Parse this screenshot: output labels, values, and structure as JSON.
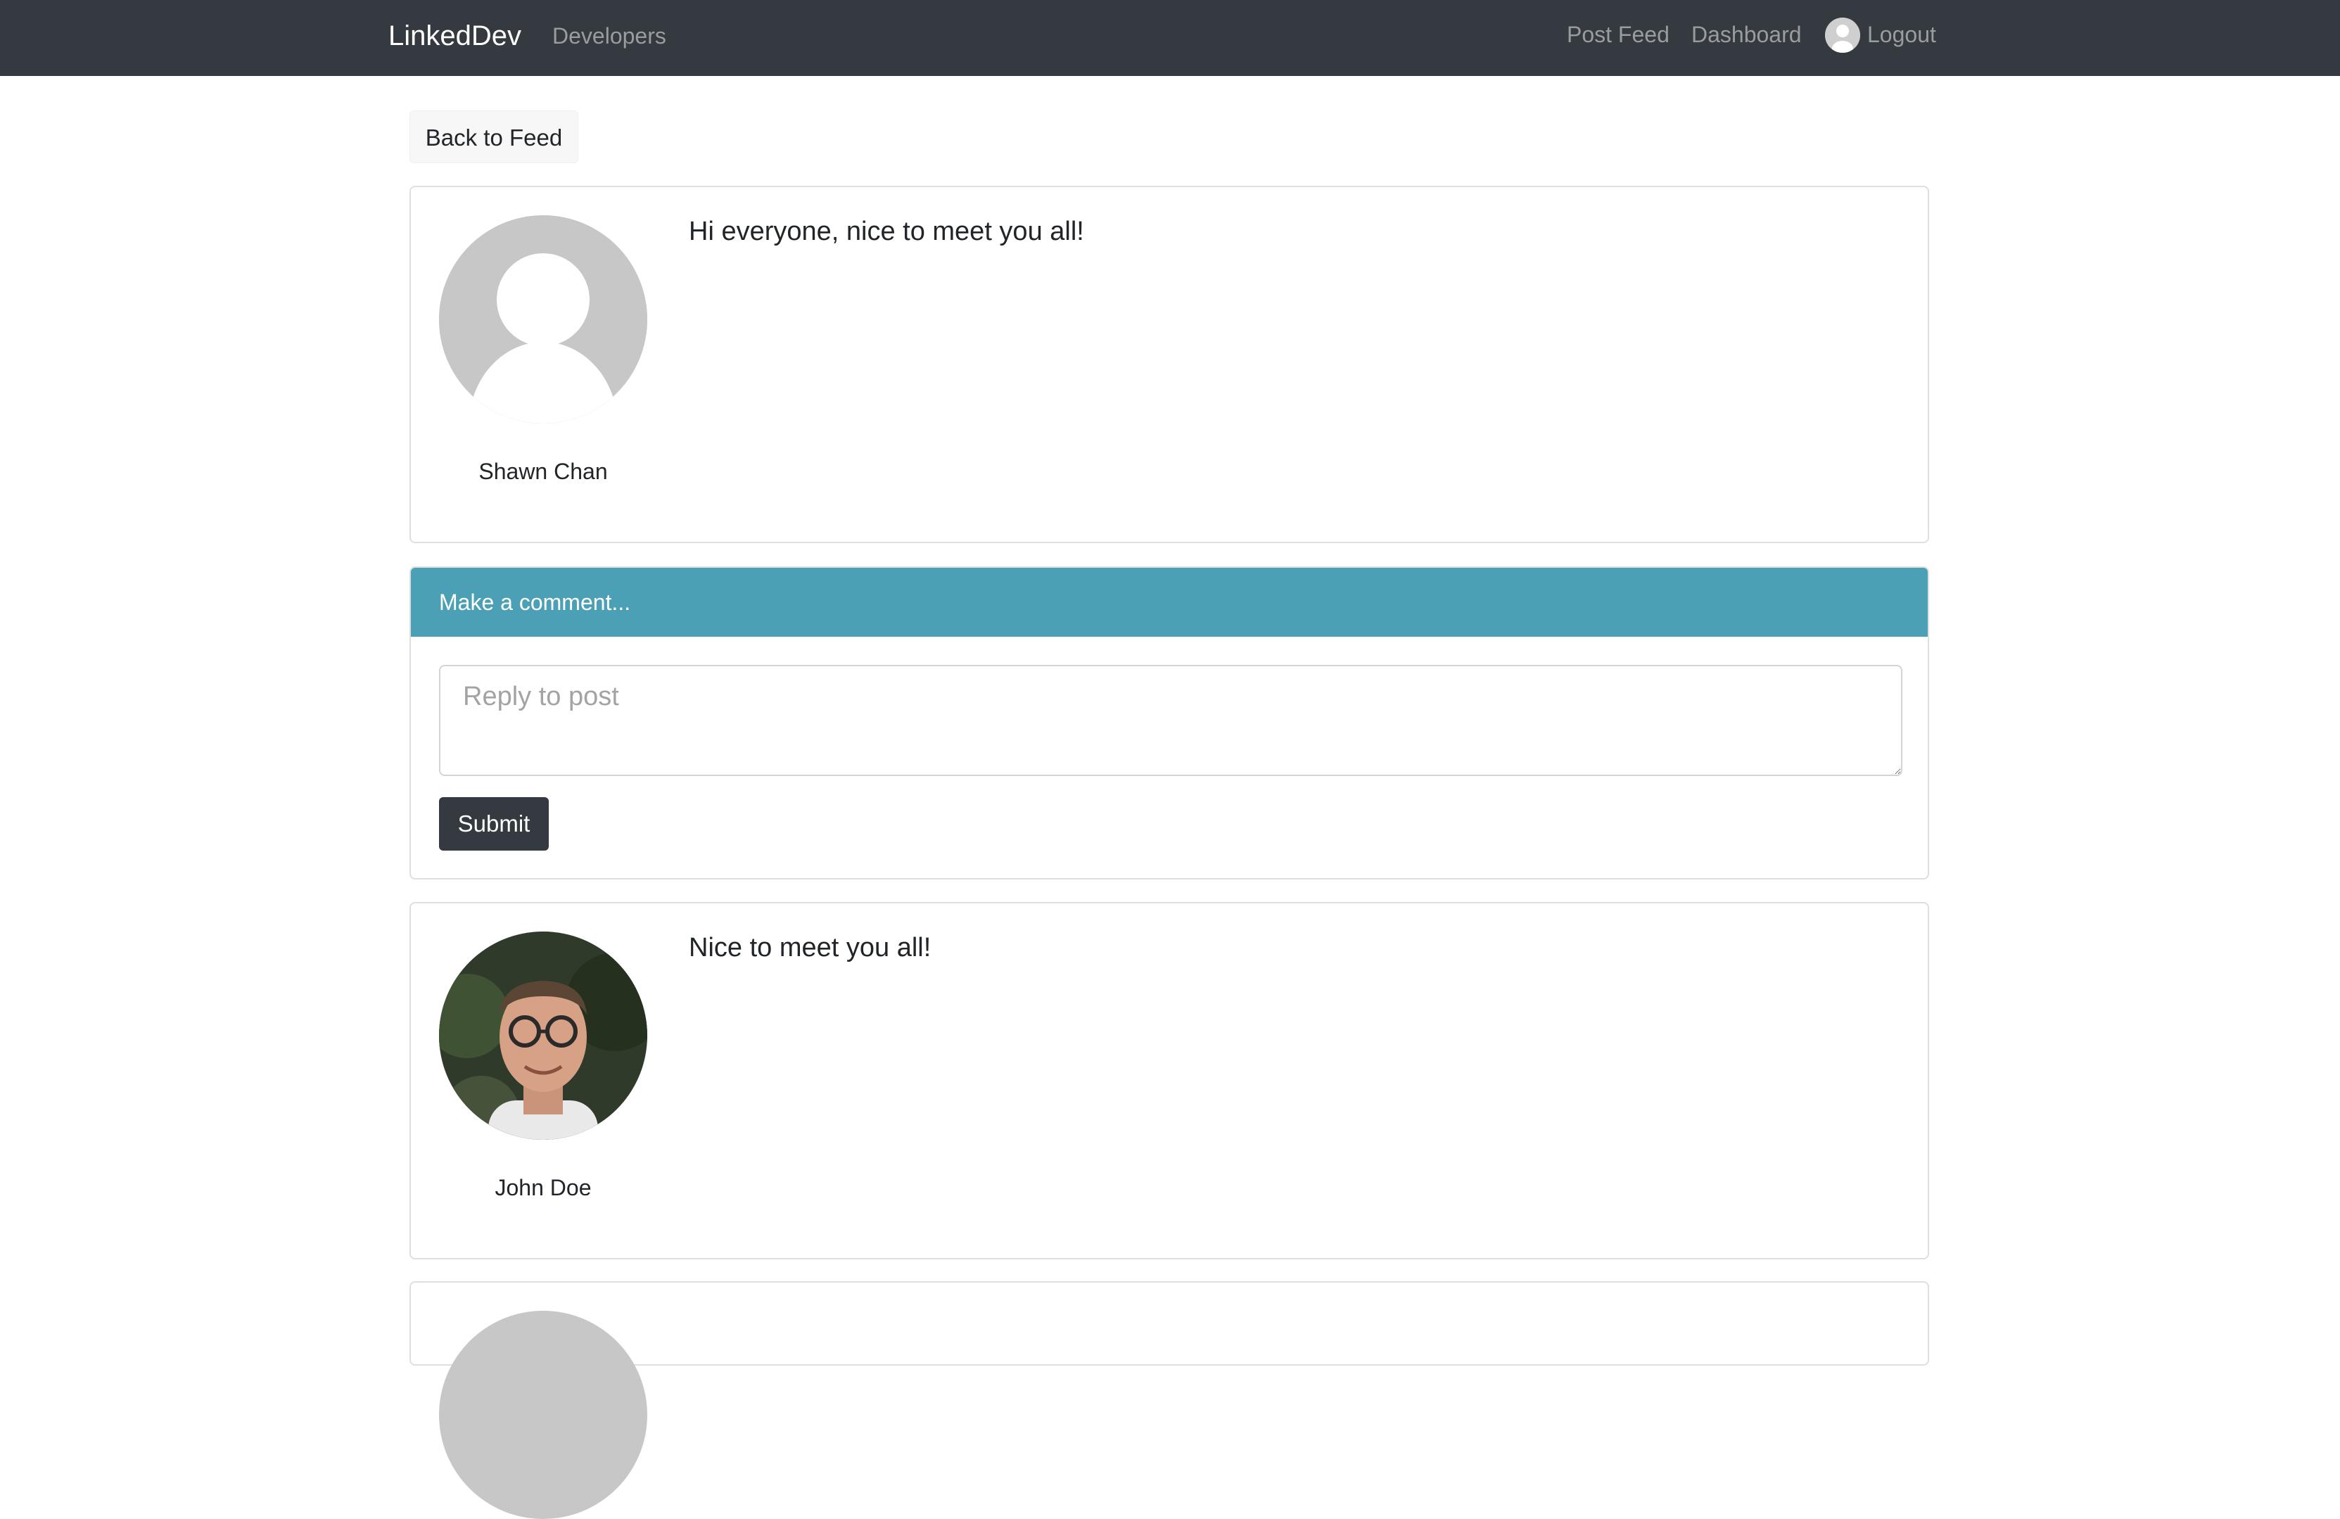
{
  "navbar": {
    "brand": "LinkedDev",
    "developers": "Developers",
    "post_feed": "Post Feed",
    "dashboard": "Dashboard",
    "logout": "Logout"
  },
  "back_button": "Back to Feed",
  "post": {
    "author": "Shawn Chan",
    "text": "Hi everyone, nice to meet you all!"
  },
  "comment_form": {
    "header": "Make a comment...",
    "placeholder": "Reply to post",
    "submit_label": "Submit"
  },
  "comments": [
    {
      "author": "John Doe",
      "text": "Nice to meet you all!"
    }
  ],
  "colors": {
    "navbar": "#343a40",
    "comment_header": "#4ca0b6",
    "submit_button": "#343a40"
  }
}
